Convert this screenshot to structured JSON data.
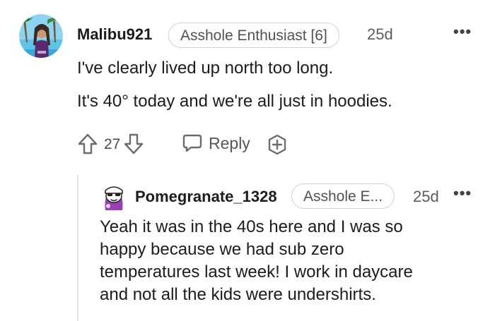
{
  "comment": {
    "username": "Malibu921",
    "flair": "Asshole Enthusiast [6]",
    "age": "25d",
    "more_menu": "•••",
    "body_lines": [
      "I've clearly lived up north too long.",
      "It's 40° today and we're all just in hoodies."
    ],
    "vote_count": "27",
    "reply_label": "Reply"
  },
  "reply": {
    "username": "Pomegranate_1328",
    "flair": "Asshole E...",
    "age": "25d",
    "more_menu": "•••",
    "body_lines": [
      "Yeah it was in the 40s here and I was so",
      "happy because we had sub zero",
      "temperatures last week! I work in daycare",
      "and not all the kids were undershirts."
    ]
  },
  "icons": {
    "upvote": "arrow-up-icon",
    "downvote": "arrow-down-icon",
    "reply": "speech-bubble-icon",
    "award": "award-icon",
    "more": "ellipsis-icon"
  },
  "colors": {
    "text": "#1c1c1c",
    "meta": "#5a5d60",
    "flair_border": "#cfd3d6",
    "thread_line": "#e2e5e7"
  }
}
